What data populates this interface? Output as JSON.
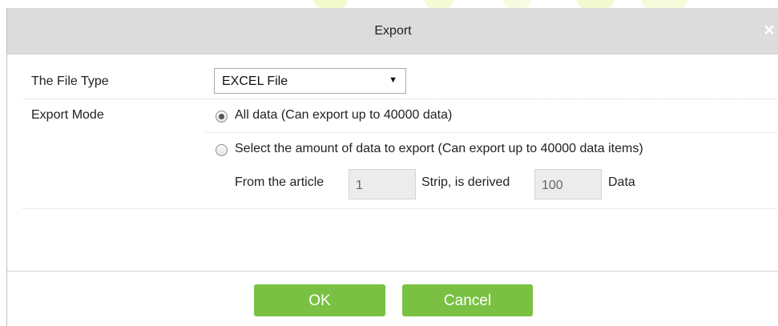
{
  "dialog": {
    "title": "Export",
    "close_icon": "close-icon"
  },
  "form": {
    "file_type": {
      "label": "The File Type",
      "selected": "EXCEL File",
      "arrow_icon": "caret-down-icon"
    },
    "export_mode": {
      "label": "Export Mode",
      "options": [
        {
          "label": "All data (Can export up to 40000 data)",
          "selected": true
        },
        {
          "label": "Select the amount of data to export (Can export up to 40000 data items)",
          "selected": false
        }
      ],
      "range": {
        "from_label": "From the article",
        "from_value": "1",
        "middle_label": "Strip, is derived",
        "count_value": "100",
        "suffix_label": "Data"
      }
    }
  },
  "buttons": {
    "ok": "OK",
    "cancel": "Cancel"
  },
  "colors": {
    "titlebar": "#dcdcdc",
    "button": "#7ac143",
    "input_bg": "#ececec"
  }
}
